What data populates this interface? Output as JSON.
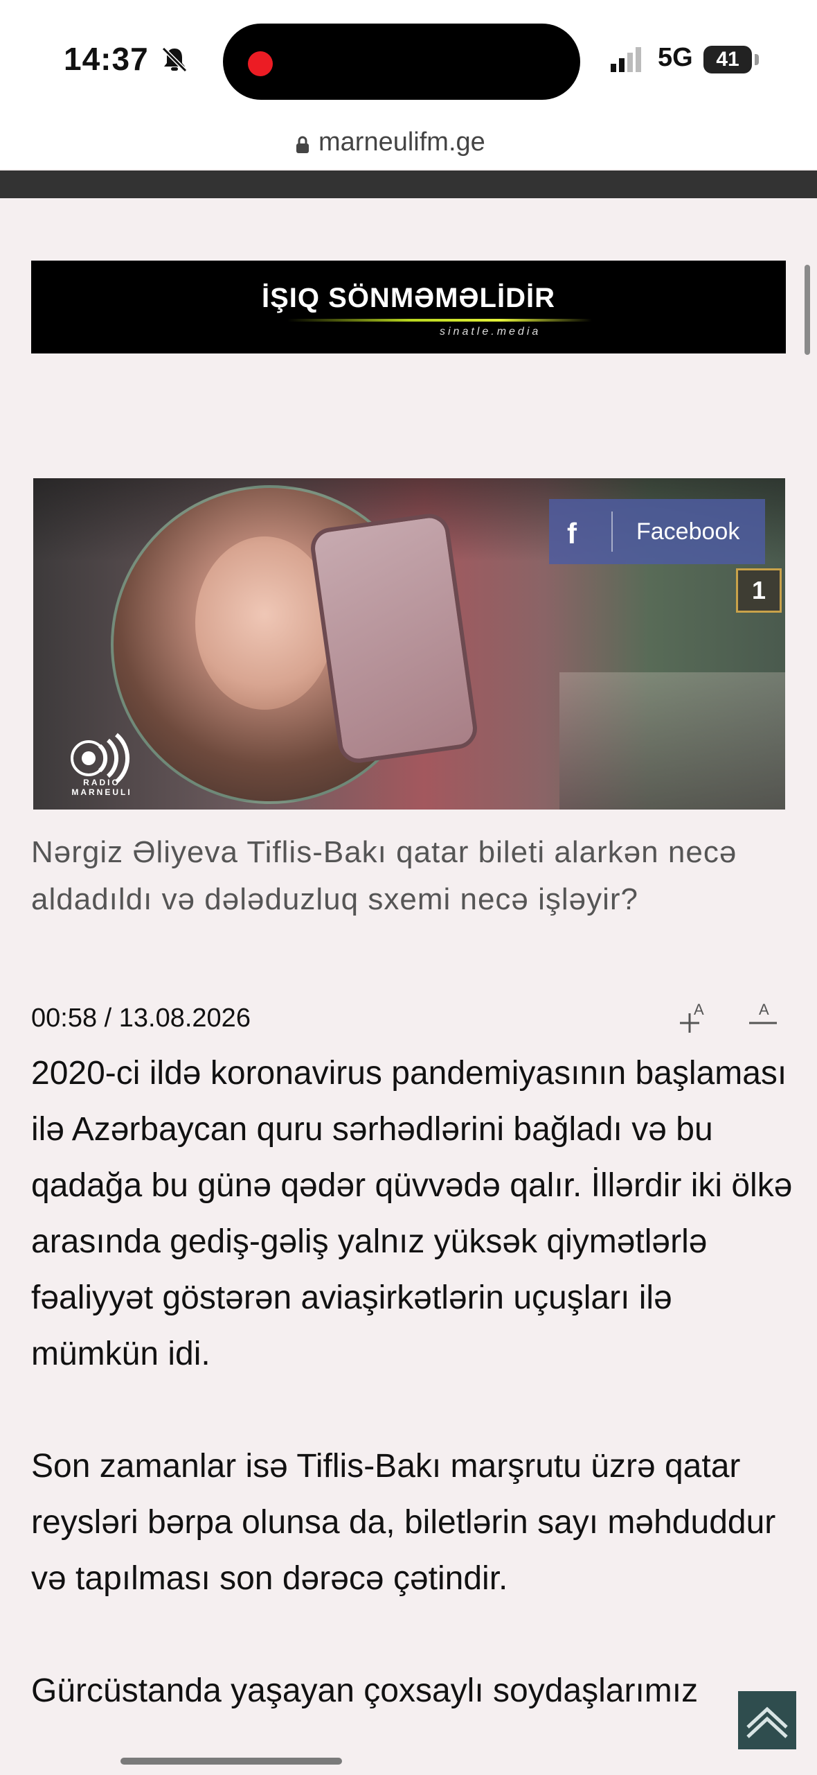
{
  "status_bar": {
    "time": "14:37",
    "network": "5G",
    "battery": "41"
  },
  "browser": {
    "url": "marneulifm.ge"
  },
  "banner": {
    "title": "İŞIQ SÖNMƏMƏLİDİR",
    "subtitle": "sinatle.media"
  },
  "hero": {
    "facebook_label": "Facebook",
    "platform_number": "1",
    "radio_logo_text": "RADIO MARNEULI"
  },
  "article": {
    "title": "Nərgiz Əliyeva Tiflis-Bakı qatar bileti alarkən necə aldadıldı və dələduzluq sxemi necə işləyir?",
    "date": "00:58 / 13.08.2026",
    "paragraphs": [
      "2020-ci ildə koronavirus pandemiyasının başlaması ilə Azərbaycan quru sərhədlərini bağladı və bu qadağa bu günə qədər qüvvədə qalır. İllərdir iki ölkə arasında gediş-gəliş yalnız yüksək qiymətlərlə fəaliyyət göstərən aviaşirkətlərin uçuşları ilə mümkün idi.",
      "Son zamanlar isə Tiflis-Bakı marşrutu üzrə qatar reysləri bərpa olunsa da, biletlərin sayı məhduddur və tapılması son dərəcə çətindir.",
      "Gürcüstanda yaşayan çoxsaylı soydaşlarımız"
    ]
  },
  "icons": {
    "bell": "bell-slash-icon",
    "lock": "lock-icon",
    "font_increase": "font-increase-icon",
    "font_decrease": "font-decrease-icon",
    "scroll_top": "chevron-up-icon"
  }
}
